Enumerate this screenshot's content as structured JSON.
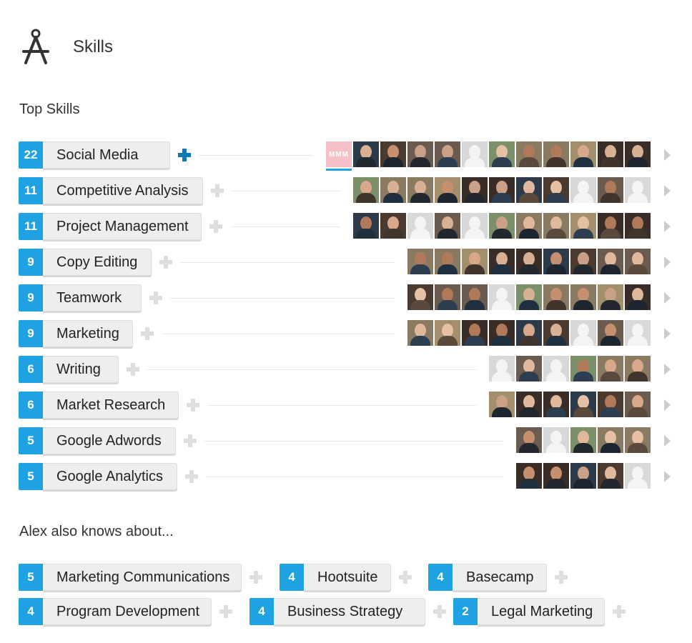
{
  "header": {
    "title": "Skills",
    "icon": "compass-icon"
  },
  "top_skills": {
    "title": "Top Skills",
    "items": [
      {
        "count": "22",
        "label": "Social Media",
        "endorsers": 12
      },
      {
        "count": "11",
        "label": "Competitive Analysis",
        "endorsers": 11
      },
      {
        "count": "11",
        "label": "Project Management",
        "endorsers": 11
      },
      {
        "count": "9",
        "label": "Copy Editing",
        "endorsers": 9
      },
      {
        "count": "9",
        "label": "Teamwork",
        "endorsers": 9
      },
      {
        "count": "9",
        "label": "Marketing",
        "endorsers": 9
      },
      {
        "count": "6",
        "label": "Writing",
        "endorsers": 6
      },
      {
        "count": "6",
        "label": "Market Research",
        "endorsers": 6
      },
      {
        "count": "5",
        "label": "Google Adwords",
        "endorsers": 5
      },
      {
        "count": "5",
        "label": "Google Analytics",
        "endorsers": 5
      }
    ]
  },
  "also_knows": {
    "title": "Alex also knows about...",
    "items": [
      {
        "count": "5",
        "label": "Marketing Communications"
      },
      {
        "count": "4",
        "label": "Hootsuite"
      },
      {
        "count": "4",
        "label": "Basecamp"
      },
      {
        "count": "4",
        "label": "Program Development"
      },
      {
        "count": "4",
        "label": "Business Strategy"
      },
      {
        "count": "2",
        "label": "Legal Marketing"
      }
    ]
  },
  "colors": {
    "count_badge": "#1fa2e1",
    "active_plus": "#0b78b8"
  }
}
